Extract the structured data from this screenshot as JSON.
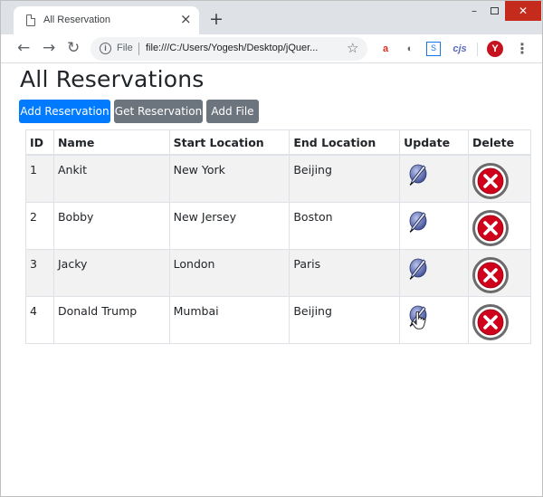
{
  "browser": {
    "tab_title": "All Reservation",
    "tab_close": "×",
    "new_tab": "+",
    "win_min": "–",
    "win_close": "✕",
    "nav_back": "←",
    "nav_forward": "→",
    "nav_reload": "↻",
    "info": "i",
    "scheme_label": "File",
    "url": "file:///C:/Users/Yogesh/Desktop/jQuer...",
    "star": "☆",
    "extensions": [
      "a",
      "◐",
      "S",
      "cjs"
    ],
    "profile_letter": "Y",
    "menu": "⋮"
  },
  "page": {
    "title": "All Reservations",
    "buttons": {
      "add": "Add Reservation",
      "get": "Get Reservation",
      "file": "Add File"
    },
    "table": {
      "headers": [
        "ID",
        "Name",
        "Start Location",
        "End Location",
        "Update",
        "Delete"
      ],
      "rows": [
        {
          "id": "1",
          "name": "Ankit",
          "start": "New York",
          "end": "Beijing"
        },
        {
          "id": "2",
          "name": "Bobby",
          "start": "New Jersey",
          "end": "Boston"
        },
        {
          "id": "3",
          "name": "Jacky",
          "start": "London",
          "end": "Paris"
        },
        {
          "id": "4",
          "name": "Donald Trump",
          "start": "Mumbai",
          "end": "Beijing"
        }
      ]
    }
  },
  "colors": {
    "primary": "#007bff",
    "secondary": "#6c757d",
    "delete_red": "#d0021b",
    "update_blue": "#4a5aa8"
  },
  "icons": {
    "update": "quill-pen-icon",
    "delete": "close-circle-icon",
    "cursor": "hand-pointer-icon"
  }
}
